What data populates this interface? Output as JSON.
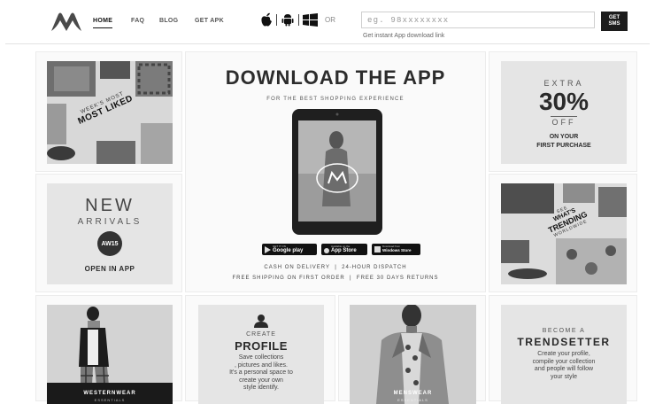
{
  "header": {
    "nav": [
      {
        "label": "HOME",
        "active": true
      },
      {
        "label": "FAQ",
        "active": false
      },
      {
        "label": "BLOG",
        "active": false
      },
      {
        "label": "GET APK",
        "active": false
      }
    ],
    "platform_icons": [
      "apple-icon",
      "android-icon",
      "windows-icon"
    ],
    "or_text": "OR",
    "phone_placeholder": "eg. 98xxxxxxxx",
    "sms_button": {
      "line1": "GET",
      "line2": "SMS"
    },
    "instant_link": "Get instant App download link"
  },
  "tiles": {
    "most_liked": {
      "line1": "WEEK'S MOST",
      "line2": "MOST LIKED"
    },
    "new_arrivals": {
      "title": "NEW",
      "subtitle": "ARRIVALS",
      "badge": "AW15",
      "cta": "OPEN IN APP"
    },
    "download": {
      "title": "DOWNLOAD THE APP",
      "subtitle": "FOR THE BEST SHOPPING EXPERIENCE",
      "stores": [
        {
          "small": "GET IT ON",
          "big": "Google play"
        },
        {
          "small": "Available on the",
          "big": "App Store"
        },
        {
          "small": "Download from",
          "big": "Windows Store"
        }
      ],
      "line1": "CASH ON DELIVERY  |  24-HOUR DISPATCH",
      "line2": "FREE SHIPPING ON FIRST ORDER  |  FREE 30 DAYS RETURNS"
    },
    "extra_off": {
      "line1": "EXTRA",
      "percent": "30%",
      "line3": "OFF",
      "line4": "ON YOUR",
      "line5": "FIRST PURCHASE"
    },
    "trending": {
      "line1": "SEE",
      "line2": "WHAT'S",
      "line3": "TRENDING",
      "line4": "WORLDWIDE"
    },
    "westernwear": {
      "title": "WESTERNWEAR",
      "subtitle": "ESSENTIALS"
    },
    "create_profile": {
      "kicker": "CREATE",
      "title": "PROFILE",
      "body": [
        "Save collections",
        ", pictures and likes.",
        "It's a personal space to",
        "create your own",
        "style identify."
      ]
    },
    "menswear": {
      "title": "MENSWEAR",
      "subtitle": "ESSENTIALS"
    },
    "trendsetter": {
      "kicker": "BECOME A",
      "title": "TRENDSETTER",
      "body": [
        "Create your profile,",
        "compile your collection",
        "and people will follow",
        "your style"
      ]
    }
  }
}
